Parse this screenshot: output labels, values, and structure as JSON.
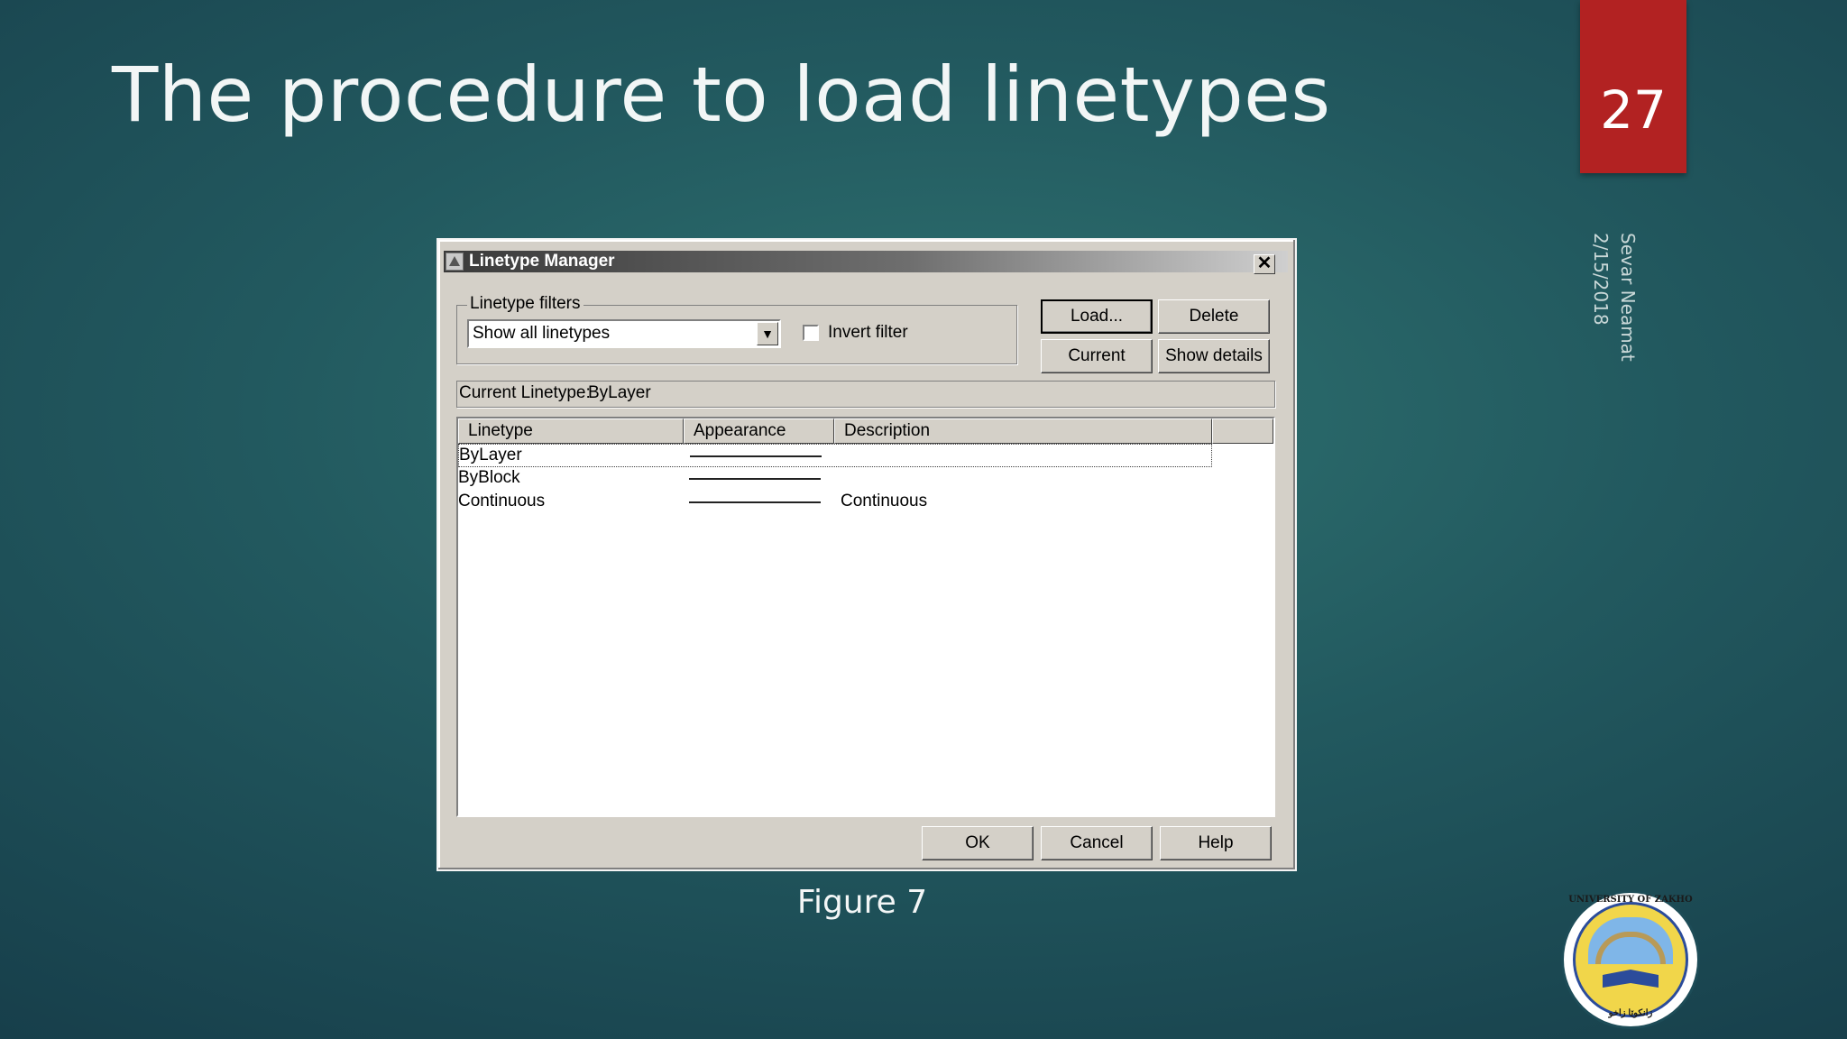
{
  "slide": {
    "title": "The procedure to load linetypes",
    "page_number": "27",
    "author": "Sevar Neamat",
    "date": "2/15/2018",
    "caption": "Figure 7",
    "logo": {
      "top_text": "UNIVERSITY OF ZAKHO",
      "bottom_text": "زانكوێا زاخو"
    }
  },
  "dialog": {
    "title": "Linetype Manager",
    "close_symbol": "✕",
    "filters_group_label": "Linetype filters",
    "filter_value": "Show all linetypes",
    "dropdown_arrow": "▼",
    "invert_filter_label": "Invert filter",
    "invert_filter_checked": false,
    "buttons": {
      "load": "Load...",
      "delete": "Delete",
      "current": "Current",
      "show_details": "Show details",
      "ok": "OK",
      "cancel": "Cancel",
      "help": "Help"
    },
    "current_linetype_label": "Current Linetype:",
    "current_linetype_value": "ByLayer",
    "columns": [
      "Linetype",
      "Appearance",
      "Description"
    ],
    "rows": [
      {
        "linetype": "ByLayer",
        "description": ""
      },
      {
        "linetype": "ByBlock",
        "description": ""
      },
      {
        "linetype": "Continuous",
        "description": "Continuous"
      }
    ]
  },
  "colors": {
    "background": "#22595f",
    "page_badge": "#b22222",
    "dialog_face": "#d4d0c8"
  }
}
